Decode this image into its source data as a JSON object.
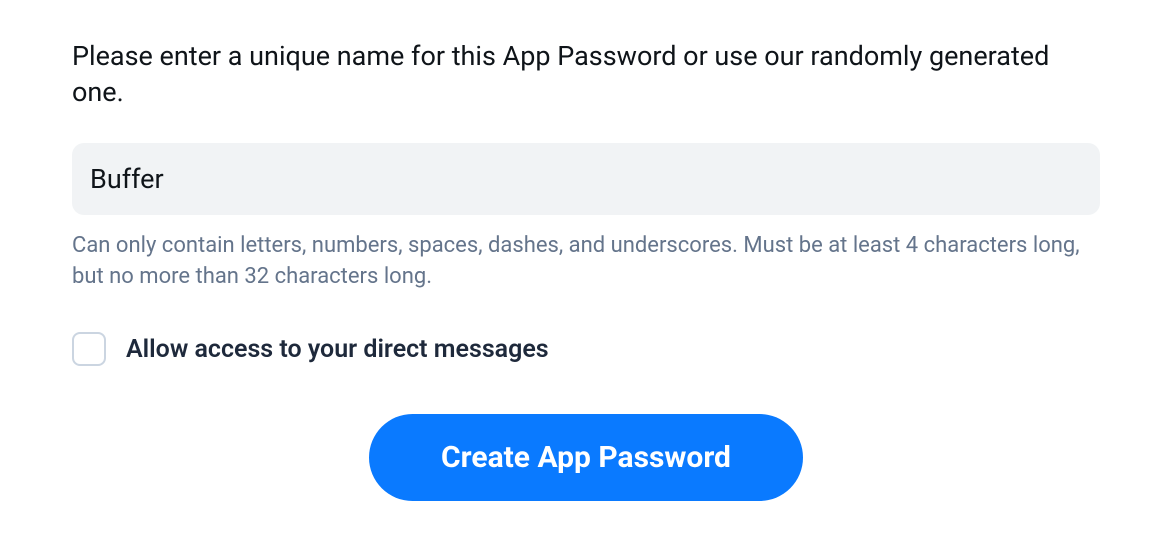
{
  "form": {
    "instruction": "Please enter a unique name for this App Password or use our randomly generated one.",
    "name_value": "Buffer",
    "hint": "Can only contain letters, numbers, spaces, dashes, and underscores. Must be at least 4 characters long, but no more than 32 characters long.",
    "allow_dm_label": "Allow access to your direct messages",
    "allow_dm_checked": false,
    "submit_label": "Create App Password"
  },
  "colors": {
    "accent": "#0a7aff",
    "input_bg": "#f1f3f5",
    "hint_text": "#64748b"
  }
}
